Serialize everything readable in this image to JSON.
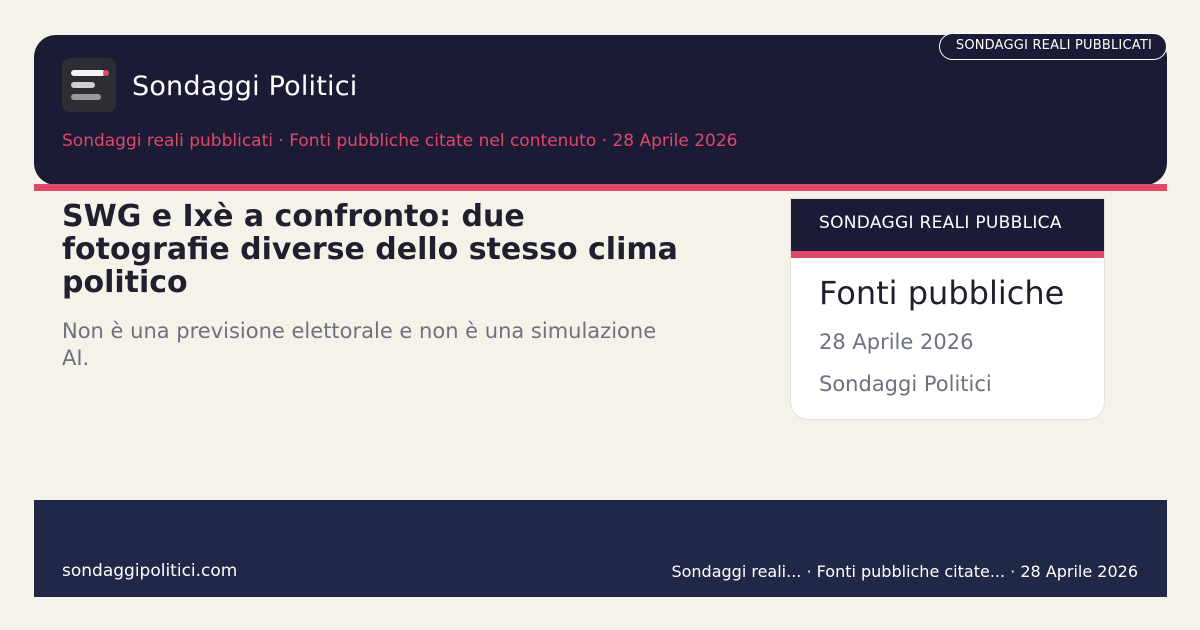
{
  "header": {
    "brand": "Sondaggi Politici",
    "badge": "SONDAGGI REALI PUBBLICATI",
    "meta": {
      "status": "Sondaggi reali pubblicati",
      "sources": "Fonti pubbliche citate nel contenuto",
      "date": "28 Aprile 2026",
      "separator": " · "
    }
  },
  "main": {
    "title": "SWG e Ixè a confronto: due fotografie diverse dello stesso clima politico",
    "subtitle": "Non è una previsione elettorale e non è una simulazione AI."
  },
  "card": {
    "label": "SONDAGGI REALI PUBBLICA",
    "title": "Fonti pubbliche",
    "date": "28 Aprile 2026",
    "source": "Sondaggi Politici"
  },
  "footer": {
    "site": "sondaggipolitici.com",
    "meta": "Sondaggi reali... · Fonti pubbliche citate... · 28 Aprile 2026"
  },
  "colors": {
    "navy": "#1c1b35",
    "accent": "#e0486a",
    "footer": "#212747",
    "background": "#f5f2ea"
  },
  "icons": {
    "logo": "lines-logo-icon"
  }
}
